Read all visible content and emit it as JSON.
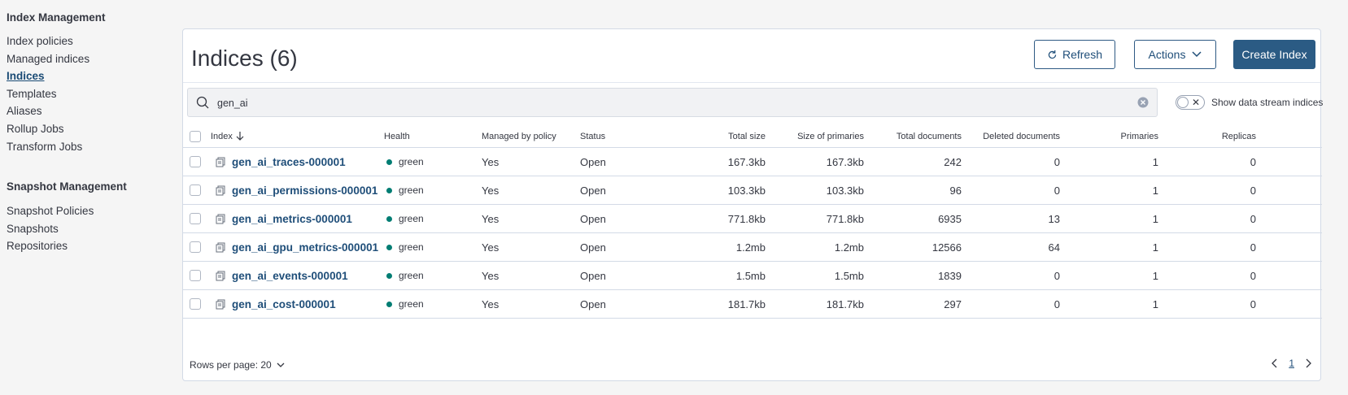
{
  "sidebar": {
    "heading_index": "Index Management",
    "index_items": [
      {
        "label": "Index policies"
      },
      {
        "label": "Managed indices"
      },
      {
        "label": "Indices"
      },
      {
        "label": "Templates"
      },
      {
        "label": "Aliases"
      },
      {
        "label": "Rollup Jobs"
      },
      {
        "label": "Transform Jobs"
      }
    ],
    "active_item": "Indices",
    "heading_snapshot": "Snapshot Management",
    "snapshot_items": [
      {
        "label": "Snapshot Policies"
      },
      {
        "label": "Snapshots"
      },
      {
        "label": "Repositories"
      }
    ]
  },
  "header": {
    "title": "Indices (6)",
    "refresh_label": "Refresh",
    "actions_label": "Actions",
    "create_label": "Create Index"
  },
  "search": {
    "value": "gen_ai",
    "placeholder": "Search"
  },
  "toggle": {
    "label": "Show data stream indices",
    "on": false
  },
  "table": {
    "columns": {
      "index": "Index",
      "health": "Health",
      "managed": "Managed by policy",
      "status": "Status",
      "total_size": "Total size",
      "size_primaries": "Size of primaries",
      "total_docs": "Total documents",
      "deleted_docs": "Deleted documents",
      "primaries": "Primaries",
      "replicas": "Replicas"
    },
    "rows": [
      {
        "index": "gen_ai_traces-000001",
        "health": "green",
        "managed": "Yes",
        "status": "Open",
        "total_size": "167.3kb",
        "size_primaries": "167.3kb",
        "total_docs": "242",
        "deleted_docs": "0",
        "primaries": "1",
        "replicas": "0"
      },
      {
        "index": "gen_ai_permissions-000001",
        "health": "green",
        "managed": "Yes",
        "status": "Open",
        "total_size": "103.3kb",
        "size_primaries": "103.3kb",
        "total_docs": "96",
        "deleted_docs": "0",
        "primaries": "1",
        "replicas": "0"
      },
      {
        "index": "gen_ai_metrics-000001",
        "health": "green",
        "managed": "Yes",
        "status": "Open",
        "total_size": "771.8kb",
        "size_primaries": "771.8kb",
        "total_docs": "6935",
        "deleted_docs": "13",
        "primaries": "1",
        "replicas": "0"
      },
      {
        "index": "gen_ai_gpu_metrics-000001",
        "health": "green",
        "managed": "Yes",
        "status": "Open",
        "total_size": "1.2mb",
        "size_primaries": "1.2mb",
        "total_docs": "12566",
        "deleted_docs": "64",
        "primaries": "1",
        "replicas": "0"
      },
      {
        "index": "gen_ai_events-000001",
        "health": "green",
        "managed": "Yes",
        "status": "Open",
        "total_size": "1.5mb",
        "size_primaries": "1.5mb",
        "total_docs": "1839",
        "deleted_docs": "0",
        "primaries": "1",
        "replicas": "0"
      },
      {
        "index": "gen_ai_cost-000001",
        "health": "green",
        "managed": "Yes",
        "status": "Open",
        "total_size": "181.7kb",
        "size_primaries": "181.7kb",
        "total_docs": "297",
        "deleted_docs": "0",
        "primaries": "1",
        "replicas": "0"
      }
    ]
  },
  "footer": {
    "rows_per_page": "Rows per page: 20",
    "current_page": "1"
  },
  "colors": {
    "accent": "#2b5b84",
    "link": "#1f4e79",
    "health_green": "#017d73"
  }
}
